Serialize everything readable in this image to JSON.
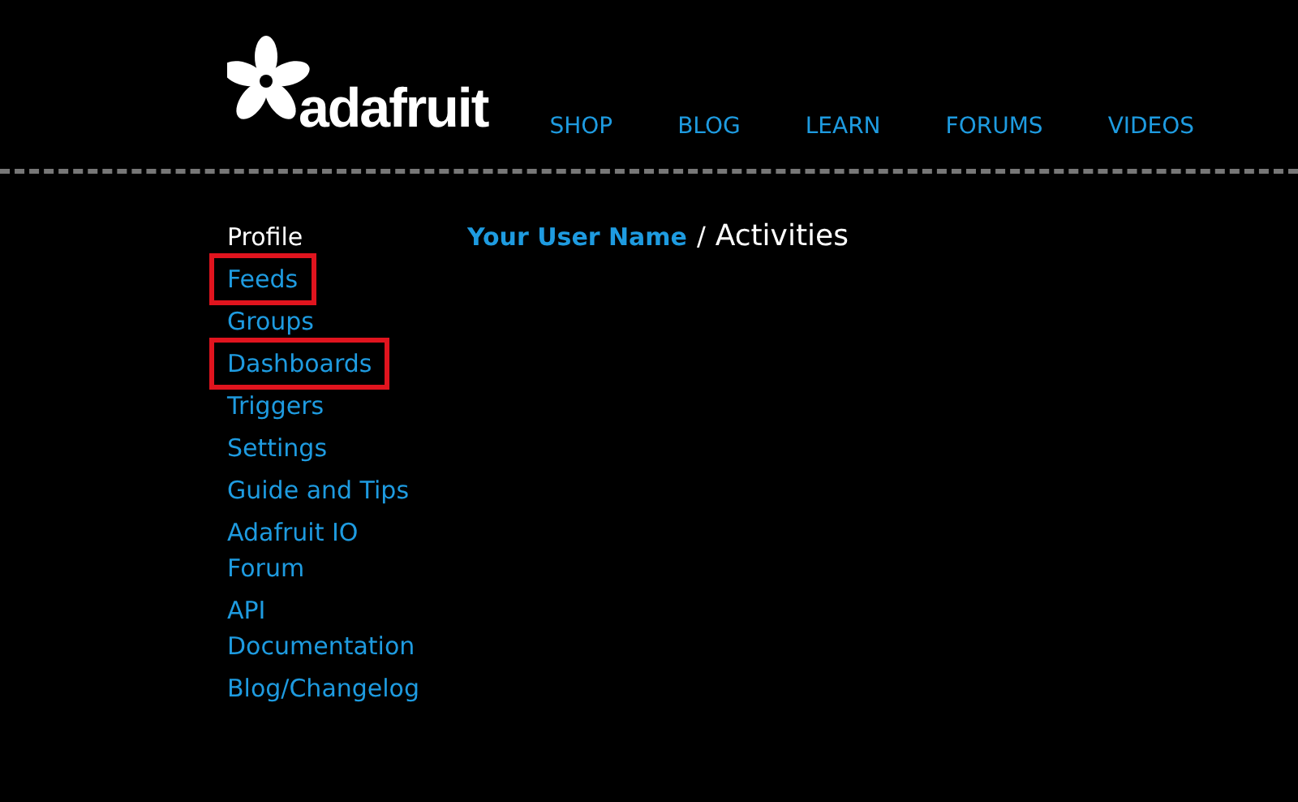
{
  "header": {
    "logo_text": "adafruit",
    "nav": [
      "SHOP",
      "BLOG",
      "LEARN",
      "FORUMS",
      "VIDEOS"
    ]
  },
  "sidebar": {
    "items": [
      {
        "label": "Profile",
        "selected": true,
        "highlighted": false
      },
      {
        "label": "Feeds",
        "selected": false,
        "highlighted": true
      },
      {
        "label": "Groups",
        "selected": false,
        "highlighted": false
      },
      {
        "label": "Dashboards",
        "selected": false,
        "highlighted": true
      },
      {
        "label": "Triggers",
        "selected": false,
        "highlighted": false
      },
      {
        "label": "Settings",
        "selected": false,
        "highlighted": false
      },
      {
        "label": "Guide and Tips",
        "selected": false,
        "highlighted": false
      },
      {
        "label": "Adafruit IO Forum",
        "selected": false,
        "highlighted": false
      },
      {
        "label": "API Documentation",
        "selected": false,
        "highlighted": false
      },
      {
        "label": "Blog/Changelog",
        "selected": false,
        "highlighted": false
      }
    ]
  },
  "breadcrumb": {
    "user": "Your User Name",
    "separator": "/",
    "page": "Activities"
  }
}
